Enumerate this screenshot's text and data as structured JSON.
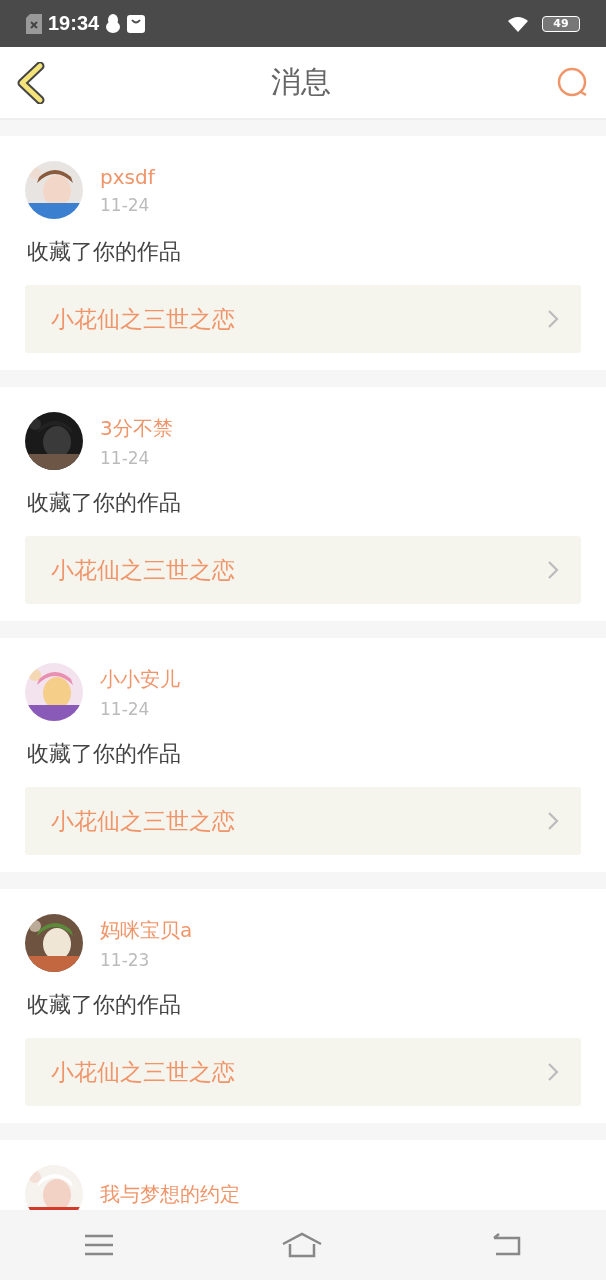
{
  "status_bar": {
    "time": "19:34",
    "battery": "49"
  },
  "header": {
    "title": "消息"
  },
  "messages": [
    {
      "user": "pxsdf",
      "date": "11-24",
      "action": "收藏了你的作品",
      "work": "小花仙之三世之恋"
    },
    {
      "user": "3分不禁",
      "date": "11-24",
      "action": "收藏了你的作品",
      "work": "小花仙之三世之恋"
    },
    {
      "user": "小小安儿",
      "date": "11-24",
      "action": "收藏了你的作品",
      "work": "小花仙之三世之恋"
    },
    {
      "user": "妈咪宝贝a",
      "date": "11-23",
      "action": "收藏了你的作品",
      "work": "小花仙之三世之恋"
    },
    {
      "user": "我与梦想的约定"
    }
  ]
}
